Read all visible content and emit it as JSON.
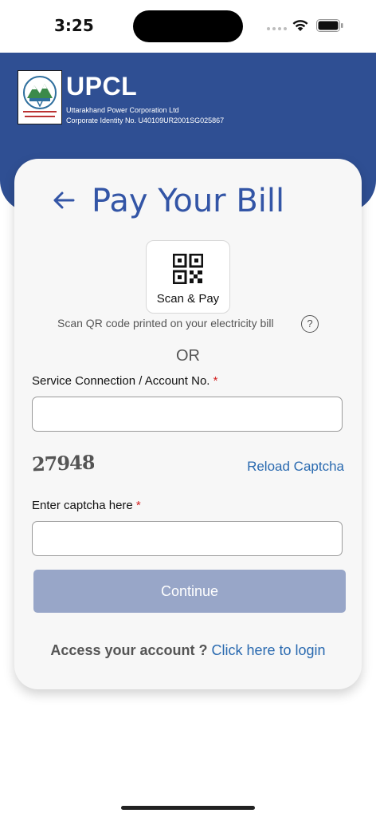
{
  "status_bar": {
    "time": "3:25"
  },
  "header": {
    "brand_name": "UPCL",
    "company_name": "Uttarakhand Power Corporation Ltd",
    "corporate_id": "Corporate Identity No. U40109UR2001SG025867",
    "colors": {
      "band": "#2f4f93"
    }
  },
  "card": {
    "title": "Pay Your Bill",
    "scan_button_label": "Scan & Pay",
    "scan_hint": "Scan QR code printed on your electricity bill",
    "help_symbol": "?",
    "or_text": "OR",
    "account_label": "Service Connection / Account No.",
    "account_value": "",
    "required_mark": "*",
    "captcha_text": "27948",
    "reload_captcha_label": "Reload Captcha",
    "captcha_label": "Enter captcha here",
    "captcha_value": "",
    "continue_label": "Continue",
    "login_prompt": "Access your account ?",
    "login_link": "Click here to login",
    "colors": {
      "title": "#3355a6",
      "link": "#2a6ab0",
      "continue_disabled": "#98a6c8",
      "required": "#d32020"
    }
  },
  "icons": [
    "back-arrow-icon",
    "qr-code-icon",
    "help-icon",
    "wifi-icon",
    "battery-icon",
    "upcl-logo"
  ]
}
